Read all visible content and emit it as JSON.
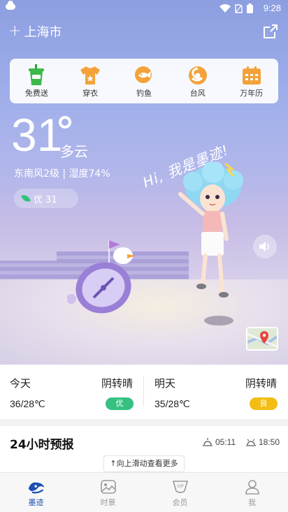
{
  "status_bar": {
    "time": "9:28"
  },
  "header": {
    "city": "上海市",
    "add_symbol": "+"
  },
  "services": [
    {
      "label": "免费送",
      "icon": "cup-gift-icon",
      "color": "#3cb84a"
    },
    {
      "label": "穿衣",
      "icon": "tshirt-icon",
      "color": "#f3a23a"
    },
    {
      "label": "钓鱼",
      "icon": "fish-icon",
      "color": "#f3a23a"
    },
    {
      "label": "台风",
      "icon": "typhoon-icon",
      "color": "#f3a23a"
    },
    {
      "label": "万年历",
      "icon": "calendar-icon",
      "color": "#f3a23a"
    }
  ],
  "current": {
    "temperature": "31",
    "condition": "多云",
    "wind_humidity": "东南风2级 | 湿度74%",
    "aqi": "优 31",
    "greeting": "Hi, 我是墨迹!"
  },
  "forecast": {
    "today": {
      "day": "今天",
      "condition": "阴转晴",
      "range": "36/28℃",
      "quality": "优",
      "quality_color": "#36c181"
    },
    "tomorrow": {
      "day": "明天",
      "condition": "阴转晴",
      "range": "35/28℃",
      "quality": "良",
      "quality_color": "#f3be13"
    }
  },
  "hourly": {
    "title": "24小时预报",
    "sunrise": "05:11",
    "sunset": "18:50"
  },
  "scroll_tip": "↑向上滑动查看更多",
  "nav": [
    {
      "label": "墨迹",
      "active": true
    },
    {
      "label": "时景",
      "active": false
    },
    {
      "label": "会员",
      "active": false
    },
    {
      "label": "我",
      "active": false
    }
  ],
  "colors": {
    "accent": "#1b4fb0",
    "sky": "#9eaeea"
  }
}
